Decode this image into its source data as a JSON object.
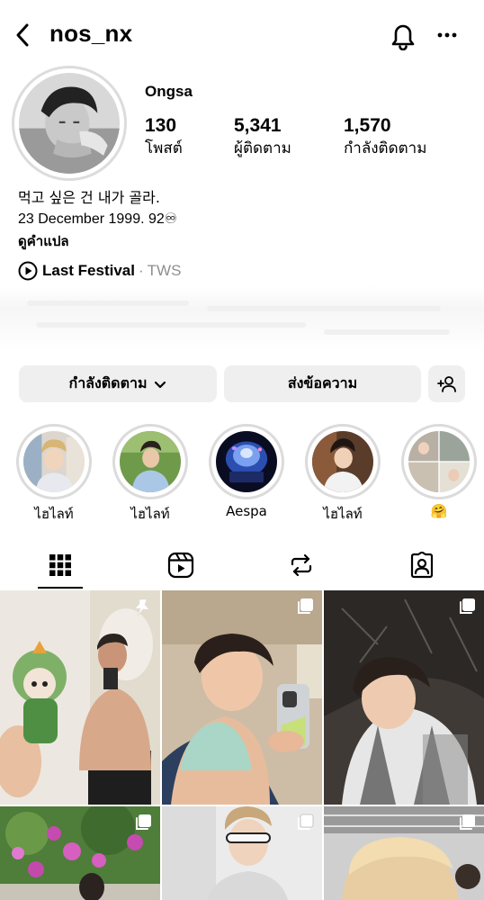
{
  "header": {
    "username": "nos_nx",
    "back_icon": "chevron-left-icon",
    "bell_icon": "bell-icon",
    "more_icon": "more-horizontal-icon"
  },
  "profile": {
    "display_name": "Ongsa",
    "stats": [
      {
        "value": "130",
        "label": "โพสต์"
      },
      {
        "value": "5,341",
        "label": "ผู้ติดตาม"
      },
      {
        "value": "1,570",
        "label": "กำลังติดตาม"
      }
    ],
    "bio": [
      "먹고 싶은 건 내가 골라.",
      "23 December 1999. 92♾"
    ],
    "translate_label": "ดูคำแปล",
    "music": {
      "song": "Last Festival",
      "separator": "·",
      "artist": "TWS"
    }
  },
  "actions": {
    "following_label": "กำลังติดตาม",
    "message_label": "ส่งข้อความ",
    "add_person_icon": "add-person-icon"
  },
  "highlights": [
    {
      "label": "ไฮไลท์"
    },
    {
      "label": "ไฮไลท์"
    },
    {
      "label": "Aespa"
    },
    {
      "label": "ไฮไลท์"
    },
    {
      "label": "🤗"
    }
  ],
  "tabs": [
    {
      "name": "grid",
      "icon": "grid-icon",
      "active": true
    },
    {
      "name": "reels",
      "icon": "reels-icon",
      "active": false
    },
    {
      "name": "reposts",
      "icon": "repost-icon",
      "active": false
    },
    {
      "name": "tagged",
      "icon": "tagged-icon",
      "active": false
    }
  ],
  "posts": [
    {
      "badge": "pin-icon"
    },
    {
      "badge": "carousel-icon"
    },
    {
      "badge": "carousel-icon"
    },
    {
      "badge": "carousel-icon"
    },
    {
      "badge": "carousel-icon"
    },
    {
      "badge": "carousel-icon"
    }
  ],
  "colors": {
    "text": "#000000",
    "secondary": "#8e8e8e",
    "button_bg": "#efefef",
    "ring": "#dbdbdb"
  }
}
